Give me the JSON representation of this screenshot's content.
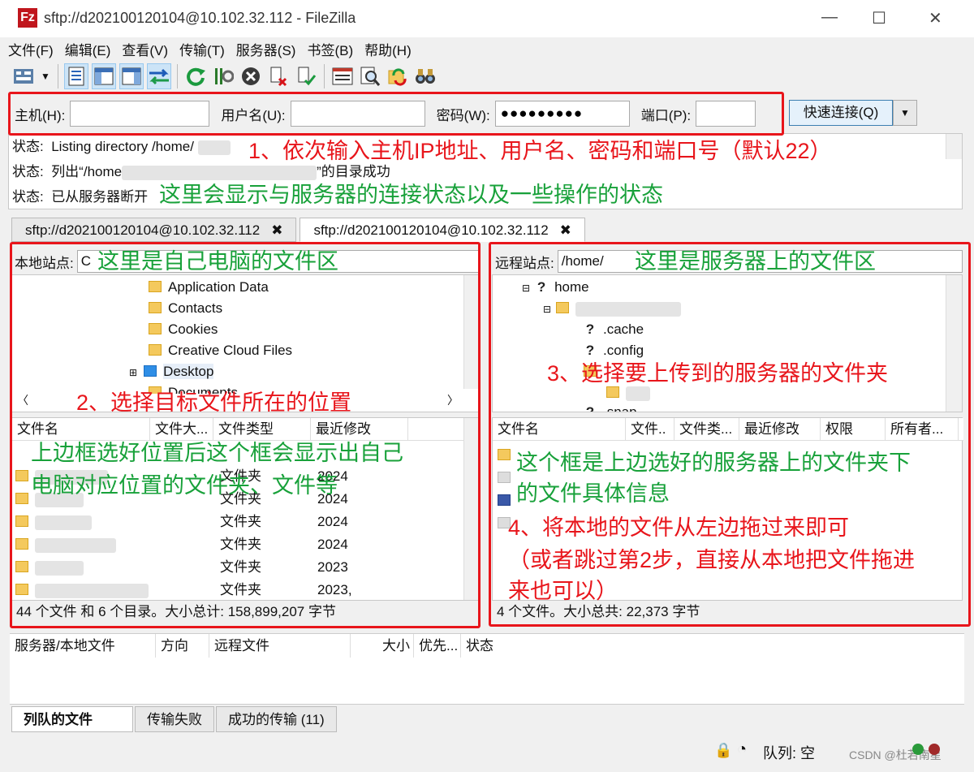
{
  "window": {
    "title": "sftp://d202100120104@10.102.32.112 - FileZilla",
    "minimize": "—",
    "maximize": "☐",
    "close": "✕"
  },
  "menu": [
    "文件(F)",
    "编辑(E)",
    "查看(V)",
    "传输(T)",
    "服务器(S)",
    "书签(B)",
    "帮助(H)"
  ],
  "quickconnect": {
    "host_label": "主机(H):",
    "user_label": "用户名(U):",
    "pass_label": "密码(W):",
    "pass_value": "●●●●●●●●●",
    "port_label": "端口(P):",
    "port_value": "",
    "button": "快速连接(Q)"
  },
  "log": [
    {
      "label": "状态:",
      "text": "Listing directory /home/"
    },
    {
      "label": "状态:",
      "text": "列出“/home",
      "suffix": "”的目录成功"
    },
    {
      "label": "状态:",
      "text": "已从服务器断开"
    }
  ],
  "tabs": [
    {
      "label": "sftp://d202100120104@10.102.32.112",
      "close": "✖"
    },
    {
      "label": "sftp://d202100120104@10.102.32.112",
      "close": "✖"
    }
  ],
  "local": {
    "site_label": "本地站点:",
    "site_value": "C",
    "tree": [
      "Application Data",
      "Contacts",
      "Cookies",
      "Creative Cloud Files",
      "Desktop",
      "Documents"
    ],
    "columns": [
      "文件名",
      "文件大...",
      "文件类型",
      "最近修改"
    ],
    "rows": [
      {
        "type": "文件夹",
        "date": "2024"
      },
      {
        "type": "文件夹",
        "date": "2024"
      },
      {
        "type": "文件夹",
        "date": "2024"
      },
      {
        "type": "文件夹",
        "date": "2024"
      },
      {
        "type": "文件夹",
        "date": "2023"
      },
      {
        "type": "文件夹",
        "date": "2023,"
      }
    ],
    "status": "44 个文件 和 6 个目录。大小总计: 158,899,207 字节"
  },
  "remote": {
    "site_label": "远程站点:",
    "site_value": "/home/",
    "tree": [
      "home",
      ".cache",
      ".config",
      ".snap"
    ],
    "columns": [
      "文件名",
      "文件..",
      "文件类...",
      "最近修改",
      "权限",
      "所有者..."
    ],
    "status": "4 个文件。大小总共: 22,373 字节"
  },
  "queue": {
    "columns": [
      "服务器/本地文件",
      "方向",
      "远程文件",
      "大小",
      "优先...",
      "状态"
    ]
  },
  "bottom_tabs": [
    "列队的文件",
    "传输失败",
    "成功的传输 (11)"
  ],
  "statusbar": {
    "queue": "队列: 空",
    "watermark": "CSDN @杜若南星"
  },
  "annotations": {
    "a1": "1、依次输入主机IP地址、用户名、密码和端口号（默认22）",
    "a_status": "这里会显示与服务器的连接状态以及一些操作的状态",
    "a_local_area": "这里是自己电脑的文件区",
    "a2": "2、选择目标文件所在的位置",
    "a_local_list_1": "上边框选好位置后这个框会显示出自己",
    "a_local_list_2": "电脑对应位置的文件夹、文件等",
    "a_remote_area": "这里是服务器上的文件区",
    "a3": "3、选择要上传到的服务器的文件夹",
    "a_remote_list_1": "这个框是上边选好的服务器上的文件夹下",
    "a_remote_list_2": "的文件具体信息",
    "a4_1": "4、将本地的文件从左边拖过来即可",
    "a4_2": "（或者跳过第2步，直接从本地把文件拖进",
    "a4_3": "来也可以）"
  },
  "colors": {
    "annotation_red": "#e8151b",
    "annotation_green": "#18a13a"
  }
}
